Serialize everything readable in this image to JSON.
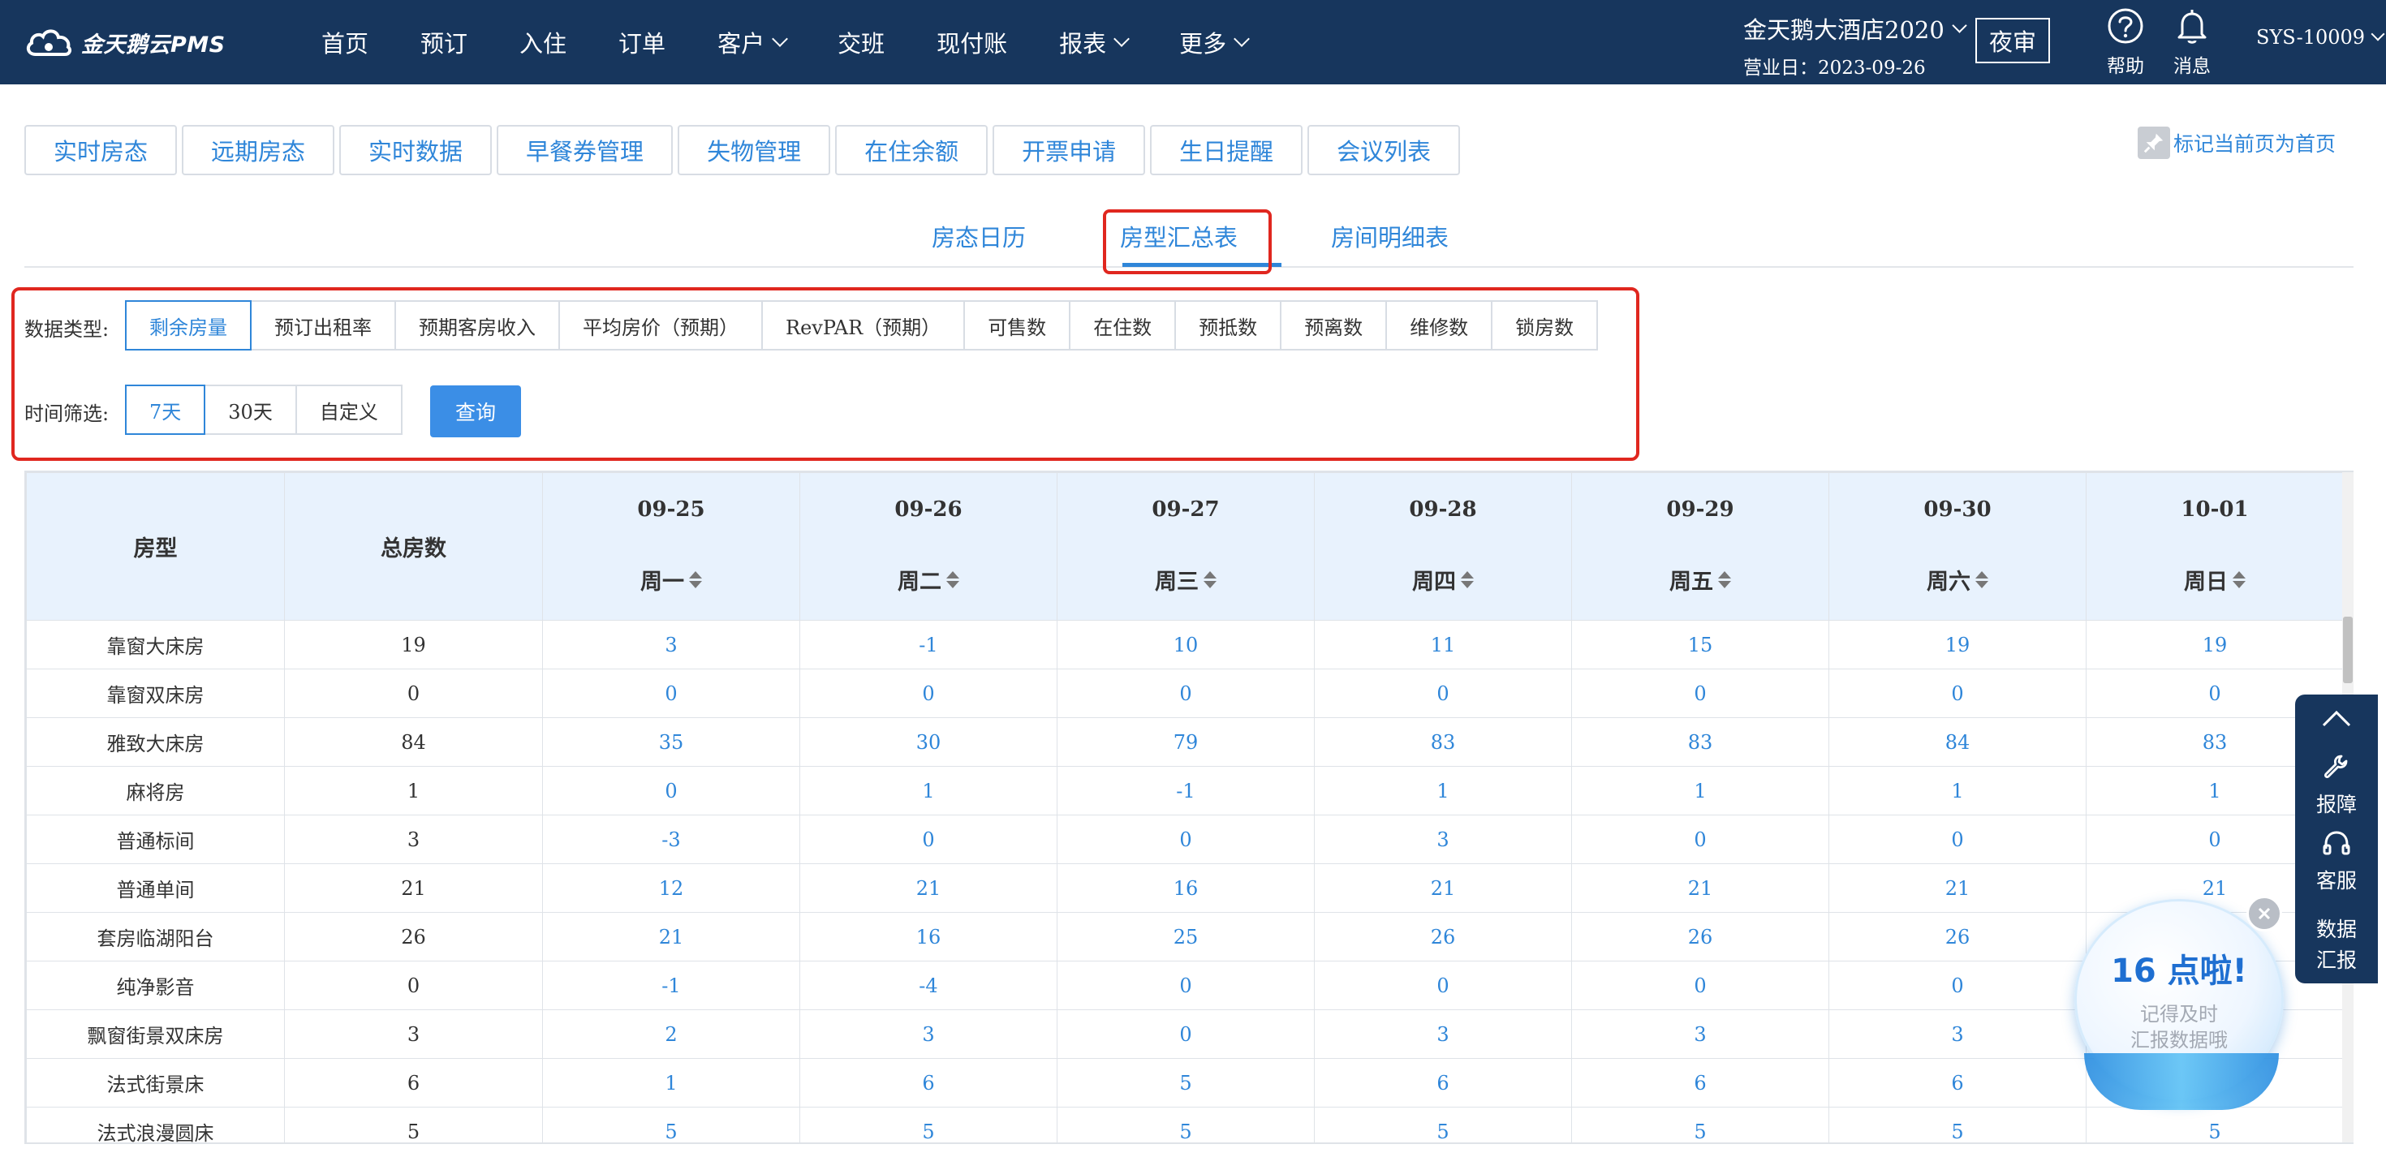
{
  "header": {
    "logo_text": "金天鹅云PMS",
    "nav": [
      {
        "label": "首页",
        "has_dropdown": false
      },
      {
        "label": "预订",
        "has_dropdown": false
      },
      {
        "label": "入住",
        "has_dropdown": false
      },
      {
        "label": "订单",
        "has_dropdown": false
      },
      {
        "label": "客户",
        "has_dropdown": true
      },
      {
        "label": "交班",
        "has_dropdown": false
      },
      {
        "label": "现付账",
        "has_dropdown": false
      },
      {
        "label": "报表",
        "has_dropdown": true
      },
      {
        "label": "更多",
        "has_dropdown": true
      }
    ],
    "hotel_name": "金天鹅大酒店2020",
    "business_date": "营业日：2023-09-26",
    "night_audit_label": "夜审",
    "help_label": "帮助",
    "messages_label": "消息",
    "user": "SYS-10009",
    "bg_color": "#17365d"
  },
  "function_tabs": [
    "实时房态",
    "远期房态",
    "实时数据",
    "早餐券管理",
    "失物管理",
    "在住余额",
    "开票申请",
    "生日提醒",
    "会议列表"
  ],
  "pin_home_label": "标记当前页为首页",
  "sub_tabs": {
    "items": [
      "房态日历",
      "房型汇总表",
      "房间明细表"
    ],
    "active": "房型汇总表"
  },
  "filters": {
    "data_type_label": "数据类型:",
    "data_types": [
      "剩余房量",
      "预订出租率",
      "预期客房收入",
      "平均房价（预期）",
      "RevPAR（预期）",
      "可售数",
      "在住数",
      "预抵数",
      "预离数",
      "维修数",
      "锁房数"
    ],
    "data_type_active": "剩余房量",
    "time_label": "时间筛选:",
    "time_options": [
      "7天",
      "30天",
      "自定义"
    ],
    "time_active": "7天",
    "query_label": "查询"
  },
  "table": {
    "col_room_type": "房型",
    "col_total": "总房数",
    "days": [
      {
        "date": "09-25",
        "weekday": "周一"
      },
      {
        "date": "09-26",
        "weekday": "周二"
      },
      {
        "date": "09-27",
        "weekday": "周三"
      },
      {
        "date": "09-28",
        "weekday": "周四"
      },
      {
        "date": "09-29",
        "weekday": "周五"
      },
      {
        "date": "09-30",
        "weekday": "周六"
      },
      {
        "date": "10-01",
        "weekday": "周日"
      }
    ],
    "rows": [
      {
        "name": "靠窗大床房",
        "total": "19",
        "values": [
          "3",
          "-1",
          "10",
          "11",
          "15",
          "19",
          "19"
        ]
      },
      {
        "name": "靠窗双床房",
        "total": "0",
        "values": [
          "0",
          "0",
          "0",
          "0",
          "0",
          "0",
          "0"
        ]
      },
      {
        "name": "雅致大床房",
        "total": "84",
        "values": [
          "35",
          "30",
          "79",
          "83",
          "83",
          "84",
          "83"
        ]
      },
      {
        "name": "麻将房",
        "total": "1",
        "values": [
          "0",
          "1",
          "-1",
          "1",
          "1",
          "1",
          "1"
        ]
      },
      {
        "name": "普通标间",
        "total": "3",
        "values": [
          "-3",
          "0",
          "0",
          "3",
          "0",
          "0",
          "0"
        ]
      },
      {
        "name": "普通单间",
        "total": "21",
        "values": [
          "12",
          "21",
          "16",
          "21",
          "21",
          "21",
          "21"
        ]
      },
      {
        "name": "套房临湖阳台",
        "total": "26",
        "values": [
          "21",
          "16",
          "25",
          "26",
          "26",
          "26",
          ""
        ]
      },
      {
        "name": "纯净影音",
        "total": "0",
        "values": [
          "-1",
          "-4",
          "0",
          "0",
          "0",
          "0",
          ""
        ]
      },
      {
        "name": "飘窗街景双床房",
        "total": "3",
        "values": [
          "2",
          "3",
          "0",
          "3",
          "3",
          "3",
          ""
        ]
      },
      {
        "name": "法式街景床",
        "total": "6",
        "values": [
          "1",
          "6",
          "5",
          "6",
          "6",
          "6",
          ""
        ]
      },
      {
        "name": "法式浪漫圆床",
        "total": "5",
        "values": [
          "5",
          "5",
          "5",
          "5",
          "5",
          "5",
          "5"
        ]
      }
    ]
  },
  "float_bar": {
    "repair_label": "报障",
    "service_label": "客服",
    "report_label_1": "数据",
    "report_label_2": "汇报"
  },
  "promo": {
    "title": "16 点啦!",
    "line1": "记得及时",
    "line2": "汇报数据哦"
  }
}
